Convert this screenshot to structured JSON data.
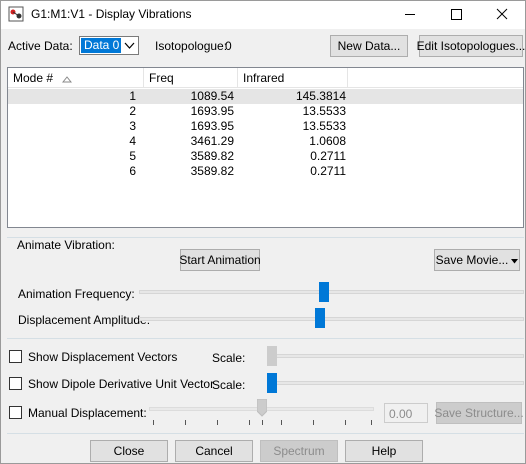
{
  "window": {
    "title": "G1:M1:V1 - Display Vibrations",
    "icons": {
      "app": "molecule-app-icon",
      "minimize": "minimize-icon",
      "maximize": "maximize-icon",
      "close": "close-icon"
    }
  },
  "top_bar": {
    "active_data_label": "Active Data:",
    "active_data_value": "Data 0",
    "isotopologue_label": "Isotopologue:",
    "isotopologue_value": "0",
    "new_data_button": "New Data...",
    "edit_isotopologues_button": "Edit Isotopologues..."
  },
  "table": {
    "columns": [
      "Mode #",
      "Freq",
      "Infrared"
    ],
    "rows": [
      {
        "mode": "1",
        "freq": "1089.54",
        "infrared": "145.3814",
        "selected": true
      },
      {
        "mode": "2",
        "freq": "1693.95",
        "infrared": "13.5533",
        "selected": false
      },
      {
        "mode": "3",
        "freq": "1693.95",
        "infrared": "13.5533",
        "selected": false
      },
      {
        "mode": "4",
        "freq": "3461.29",
        "infrared": "1.0608",
        "selected": false
      },
      {
        "mode": "5",
        "freq": "3589.82",
        "infrared": "0.2711",
        "selected": false
      },
      {
        "mode": "6",
        "freq": "3589.82",
        "infrared": "0.2711",
        "selected": false
      }
    ]
  },
  "animate": {
    "group_label": "Animate Vibration:",
    "start_button": "Start Animation",
    "save_movie_button": "Save Movie...",
    "frequency_label": "Animation Frequency:",
    "frequency_level": 0.48,
    "amplitude_label": "Displacement Amplitude:",
    "amplitude_level": 0.47
  },
  "options": {
    "show_displacement_vectors": {
      "label": "Show Displacement Vectors",
      "checked": false,
      "scale_label": "Scale:",
      "scale_level": 0.0
    },
    "show_dipole_derivative": {
      "label": "Show Dipole Derivative Unit Vector",
      "checked": false,
      "scale_label": "Scale:",
      "scale_level": 0.0
    },
    "manual_displacement": {
      "label": "Manual Displacement:",
      "checked": false,
      "value": "0.00",
      "level": 0.5,
      "save_structure_button": "Save Structure..."
    }
  },
  "footer": {
    "close_button": "Close",
    "cancel_button": "Cancel",
    "spectrum_button": "Spectrum",
    "help_button": "Help"
  }
}
